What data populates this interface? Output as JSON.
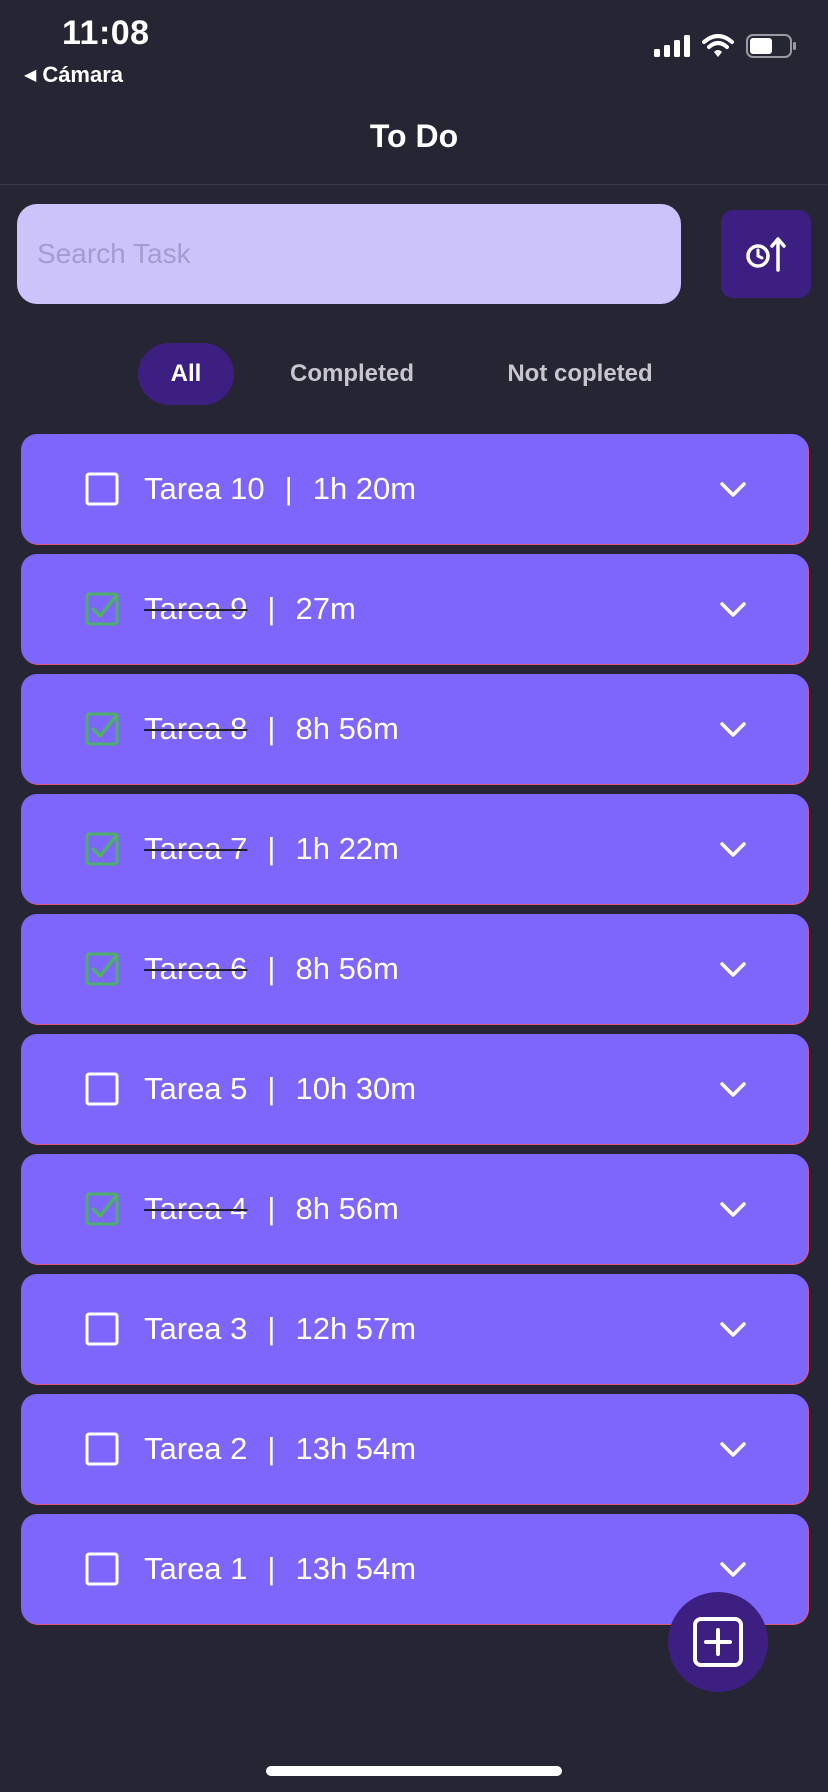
{
  "status_bar": {
    "time": "11:08",
    "back_app": "Cámara"
  },
  "nav": {
    "title": "To Do"
  },
  "search": {
    "placeholder": "Search Task",
    "value": ""
  },
  "sort_button": {
    "icon": "clock-sort-up-icon"
  },
  "filters": [
    {
      "label": "All",
      "active": true
    },
    {
      "label": "Completed",
      "active": false
    },
    {
      "label": "Not copleted",
      "active": false
    }
  ],
  "tasks": [
    {
      "name": "Tarea 10",
      "separator": "|",
      "duration": "1h 20m",
      "completed": false
    },
    {
      "name": "Tarea 9",
      "separator": "|",
      "duration": "27m",
      "completed": true
    },
    {
      "name": "Tarea 8",
      "separator": "|",
      "duration": "8h 56m",
      "completed": true
    },
    {
      "name": "Tarea 7",
      "separator": "|",
      "duration": "1h 22m",
      "completed": true
    },
    {
      "name": "Tarea 6",
      "separator": "|",
      "duration": "8h 56m",
      "completed": true
    },
    {
      "name": "Tarea 5",
      "separator": "|",
      "duration": "10h 30m",
      "completed": false
    },
    {
      "name": "Tarea 4",
      "separator": "|",
      "duration": "8h 56m",
      "completed": true
    },
    {
      "name": "Tarea 3",
      "separator": "|",
      "duration": "12h 57m",
      "completed": false
    },
    {
      "name": "Tarea 2",
      "separator": "|",
      "duration": "13h 54m",
      "completed": false
    },
    {
      "name": "Tarea 1",
      "separator": "|",
      "duration": "13h 54m",
      "completed": false
    }
  ],
  "fab": {
    "icon": "add-box-icon"
  },
  "colors": {
    "background": "#262533",
    "card": "#7e65fb",
    "accent": "#3c1f80",
    "search_bg": "#cdc3fb",
    "check_green": "#4caf6a"
  }
}
